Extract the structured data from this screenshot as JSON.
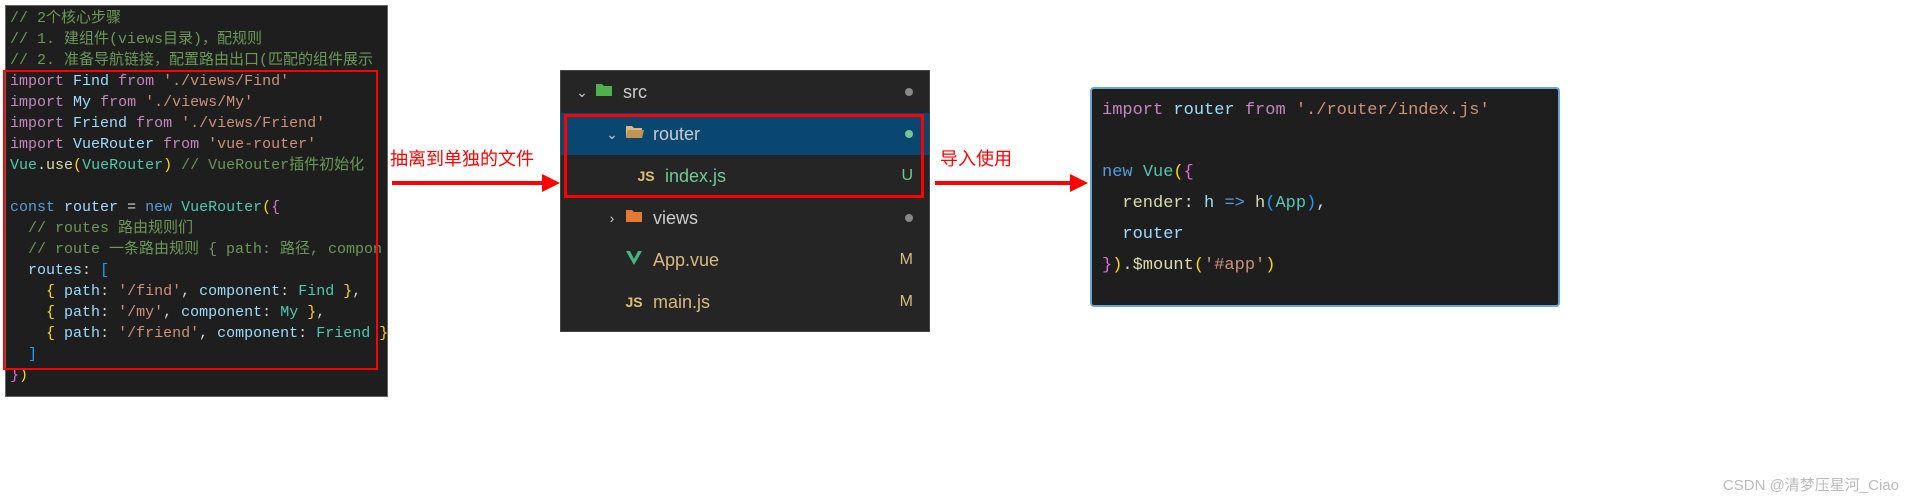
{
  "leftCode": {
    "l1": "// 2个核心步骤",
    "l2": "// 1. 建组件(views目录)，配规则",
    "l3": "// 2. 准备导航链接，配置路由出口(匹配的组件展示",
    "imp1_kw": "import",
    "imp1_name": "Find",
    "imp1_from": "from",
    "imp1_path": "'./views/Find'",
    "imp2_kw": "import",
    "imp2_name": "My",
    "imp2_from": "from",
    "imp2_path": "'./views/My'",
    "imp3_kw": "import",
    "imp3_name": "Friend",
    "imp3_from": "from",
    "imp3_path": "'./views/Friend'",
    "imp4_kw": "import",
    "imp4_name": "VueRouter",
    "imp4_from": "from",
    "imp4_path": "'vue-router'",
    "use_vue": "Vue",
    "use_method": "use",
    "use_arg": "VueRouter",
    "use_comment": "// VueRouter插件初始化",
    "const_kw": "const",
    "router_var": "router",
    "eq": "=",
    "new_kw": "new",
    "vr_class": "VueRouter",
    "routes_c1": "// routes 路由规则们",
    "routes_c2": "// route  一条路由规则 { path: 路径, compon",
    "routes_key": "routes",
    "r1_path": "'/find'",
    "r1_comp": "Find",
    "r2_path": "'/my'",
    "r2_comp": "My",
    "r3_path": "'/friend'",
    "r3_comp": "Friend",
    "path_key": "path",
    "comp_key": "component"
  },
  "arrows": {
    "label1": "抽离到单独的文件",
    "label2": "导入使用"
  },
  "tree": {
    "src": {
      "name": "src"
    },
    "router": {
      "name": "router"
    },
    "index": {
      "name": "index.js",
      "status": "U"
    },
    "views": {
      "name": "views"
    },
    "app": {
      "name": "App.vue",
      "status": "M"
    },
    "main": {
      "name": "main.js",
      "status": "M"
    }
  },
  "rightCode": {
    "imp_kw": "import",
    "imp_var": "router",
    "imp_from": "from",
    "imp_path": "'./router/index.js'",
    "new_kw": "new",
    "vue_cls": "Vue",
    "render_key": "render",
    "h1": "h",
    "arrow": "=>",
    "h2": "h",
    "app": "App",
    "router_key": "router",
    "mount": "$mount",
    "mount_arg": "'#app'"
  },
  "watermark": "CSDN @清梦压星河_Ciao"
}
